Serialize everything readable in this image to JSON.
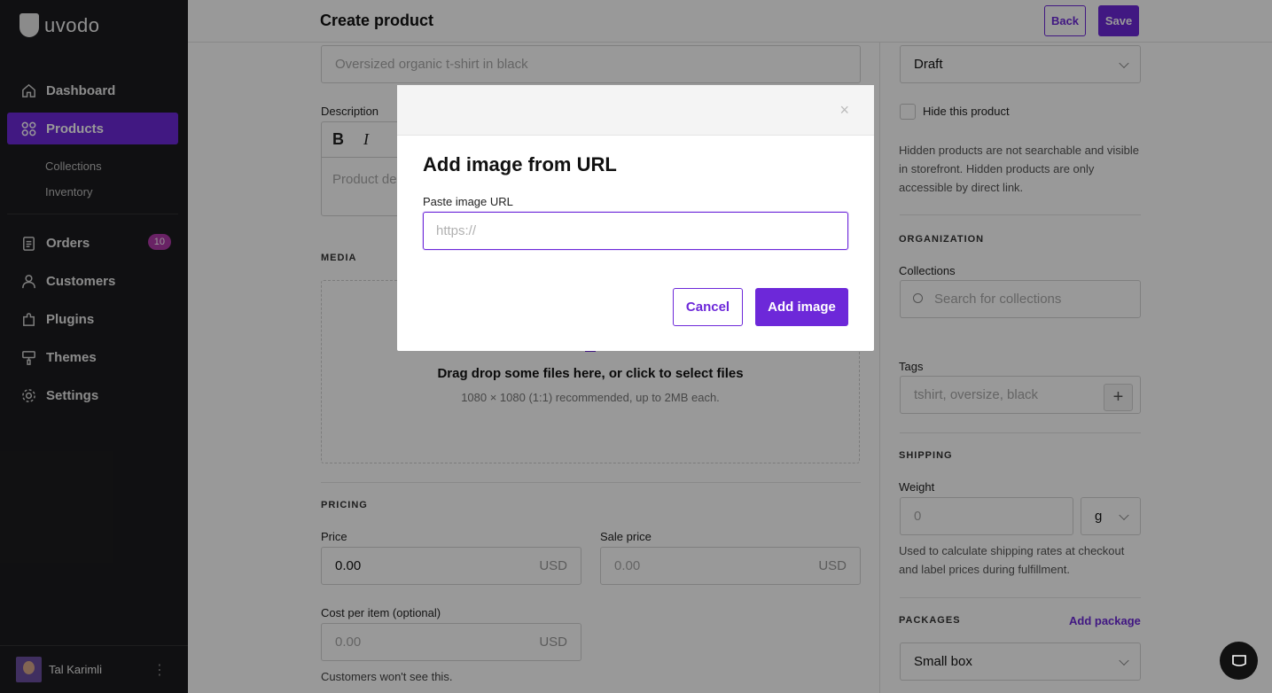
{
  "app": {
    "logo_text": "uvodo"
  },
  "sidebar": {
    "items": [
      {
        "label": "Dashboard",
        "icon": "home-icon"
      },
      {
        "label": "Products",
        "icon": "grid-icon"
      },
      {
        "label": "Orders",
        "icon": "clipboard-icon",
        "badge": "10"
      },
      {
        "label": "Customers",
        "icon": "user-icon"
      },
      {
        "label": "Plugins",
        "icon": "puzzle-icon"
      },
      {
        "label": "Themes",
        "icon": "brush-icon"
      },
      {
        "label": "Settings",
        "icon": "gear-icon"
      }
    ],
    "sub_items": [
      "Collections",
      "Inventory"
    ],
    "user": {
      "name": "Tal Karimli"
    }
  },
  "header": {
    "title": "Create product",
    "back_label": "Back",
    "save_label": "Save"
  },
  "form": {
    "title_placeholder": "Oversized organic t-shirt in black",
    "description_label": "Description",
    "description_placeholder": "Product de",
    "toolbar": {
      "bold": "B",
      "italic": "I"
    },
    "media": {
      "title": "MEDIA",
      "drop_text": "Drag drop some files here, or click to select files",
      "drop_hint": "1080 × 1080 (1:1) recommended, up to 2MB each."
    },
    "pricing": {
      "title": "PRICING",
      "price_label": "Price",
      "price_value": "0.00",
      "sale_label": "Sale price",
      "sale_placeholder": "0.00",
      "cost_label": "Cost per item (optional)",
      "cost_placeholder": "0.00",
      "currency": "USD",
      "cost_hint": "Customers won't see this."
    }
  },
  "right": {
    "status_value": "Draft",
    "hide_label": "Hide this product",
    "hide_hint": "Hidden products are not searchable and visible in storefront. Hidden products are only accessible by direct link.",
    "organization_title": "ORGANIZATION",
    "collections_label": "Collections",
    "collections_placeholder": "Search for collections",
    "tags_label": "Tags",
    "tags_placeholder": "tshirt, oversize, black",
    "shipping_title": "SHIPPING",
    "weight_label": "Weight",
    "weight_placeholder": "0",
    "weight_unit": "g",
    "shipping_hint": "Used to calculate shipping rates at checkout and label prices during fulfillment.",
    "packages_title": "PACKAGES",
    "add_package": "Add package",
    "package_value": "Small box"
  },
  "modal": {
    "close": "×",
    "title": "Add image from URL",
    "label": "Paste image URL",
    "placeholder": "https://",
    "value": "",
    "cancel_label": "Cancel",
    "add_label": "Add image"
  },
  "colors": {
    "accent": "#6d28d9",
    "sidebar_bg": "#1c1c1e",
    "badge": "#b03aa8"
  }
}
